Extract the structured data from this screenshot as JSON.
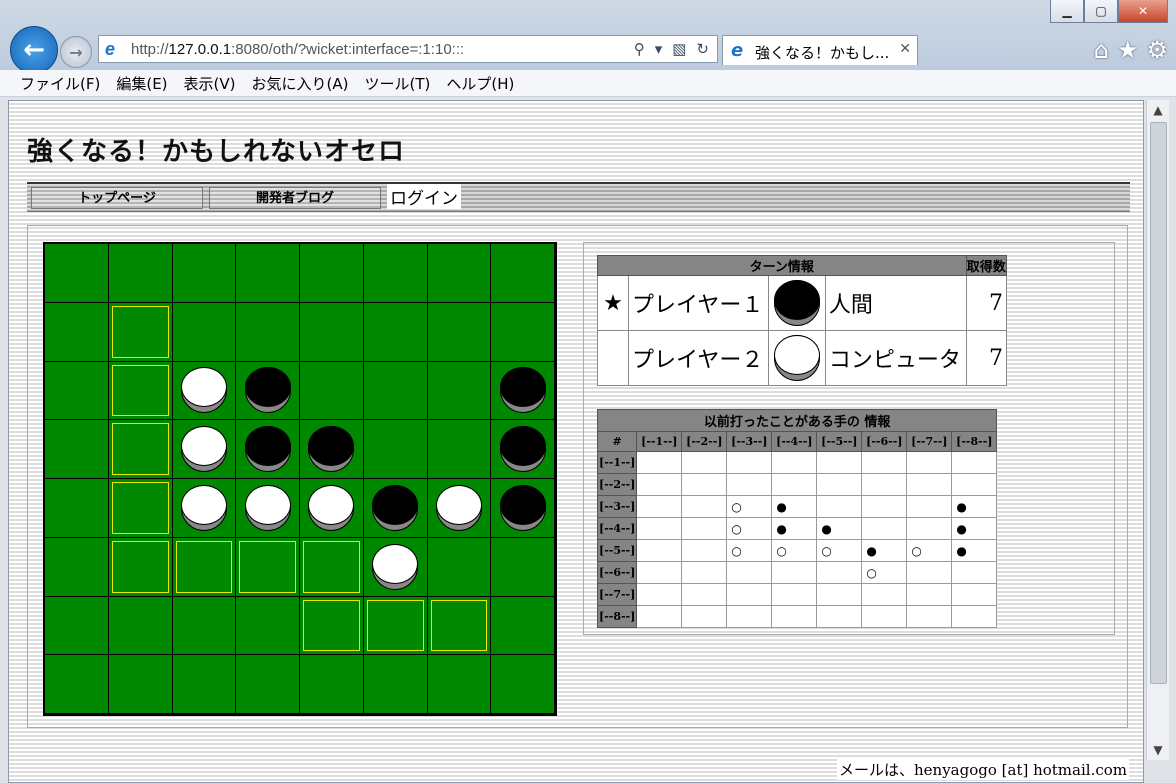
{
  "browser": {
    "url_prefix": "http://",
    "url_host": "127.0.0.1",
    "url_rest": ":8080/oth/?wicket:interface=:1:10:::",
    "tab_title": "強くなる！かもし...",
    "menu": [
      "ファイル(F)",
      "編集(E)",
      "表示(V)",
      "お気に入り(A)",
      "ツール(T)",
      "ヘルプ(H)"
    ]
  },
  "page": {
    "title": "強くなる！かもしれないオセロ",
    "nav": {
      "top": "トップページ",
      "blog": "開発者ブログ",
      "login": "ログイン"
    },
    "footer": "メールは、henyagogo [at] hotmail.com"
  },
  "board": {
    "rows": [
      [
        "",
        "",
        "",
        "",
        "",
        "",
        "",
        ""
      ],
      [
        "",
        "h",
        "",
        "",
        "",
        "",
        "",
        ""
      ],
      [
        "",
        "h",
        "W",
        "B",
        "",
        "",
        "",
        "B"
      ],
      [
        "",
        "h",
        "W",
        "B",
        "B",
        "",
        "",
        "B"
      ],
      [
        "",
        "h",
        "W",
        "W",
        "W",
        "B",
        "W",
        "B"
      ],
      [
        "",
        "h",
        "h",
        "h",
        "h",
        "W",
        "",
        ""
      ],
      [
        "",
        "",
        "",
        "",
        "h",
        "h",
        "h",
        ""
      ],
      [
        "",
        "",
        "",
        "",
        "",
        "",
        "",
        ""
      ]
    ]
  },
  "turn_info": {
    "header": "ターン情報",
    "score_header": "取得数",
    "players": [
      {
        "mark": "★",
        "name": "プレイヤー１",
        "color": "black",
        "type": "人間",
        "score": "7"
      },
      {
        "mark": "",
        "name": "プレイヤー２",
        "color": "white",
        "type": "コンピュータ",
        "score": "7"
      }
    ]
  },
  "history": {
    "title": "以前打ったことがある手の 情報",
    "corner": "#",
    "cols": [
      "[--1--]",
      "[--2--]",
      "[--3--]",
      "[--4--]",
      "[--5--]",
      "[--6--]",
      "[--7--]",
      "[--8--]"
    ],
    "rows": [
      {
        "label": "[--1--]",
        "cells": [
          "",
          "",
          "",
          "",
          "",
          "",
          "",
          ""
        ]
      },
      {
        "label": "[--2--]",
        "cells": [
          "",
          "",
          "",
          "",
          "",
          "",
          "",
          ""
        ]
      },
      {
        "label": "[--3--]",
        "cells": [
          "",
          "",
          "○",
          "●",
          "",
          "",
          "",
          "●"
        ]
      },
      {
        "label": "[--4--]",
        "cells": [
          "",
          "",
          "○",
          "●",
          "●",
          "",
          "",
          "●"
        ]
      },
      {
        "label": "[--5--]",
        "cells": [
          "",
          "",
          "○",
          "○",
          "○",
          "●",
          "○",
          "●"
        ]
      },
      {
        "label": "[--6--]",
        "cells": [
          "",
          "",
          "",
          "",
          "",
          "○",
          "",
          ""
        ]
      },
      {
        "label": "[--7--]",
        "cells": [
          "",
          "",
          "",
          "",
          "",
          "",
          "",
          ""
        ]
      },
      {
        "label": "[--8--]",
        "cells": [
          "",
          "",
          "",
          "",
          "",
          "",
          "",
          ""
        ]
      }
    ]
  }
}
